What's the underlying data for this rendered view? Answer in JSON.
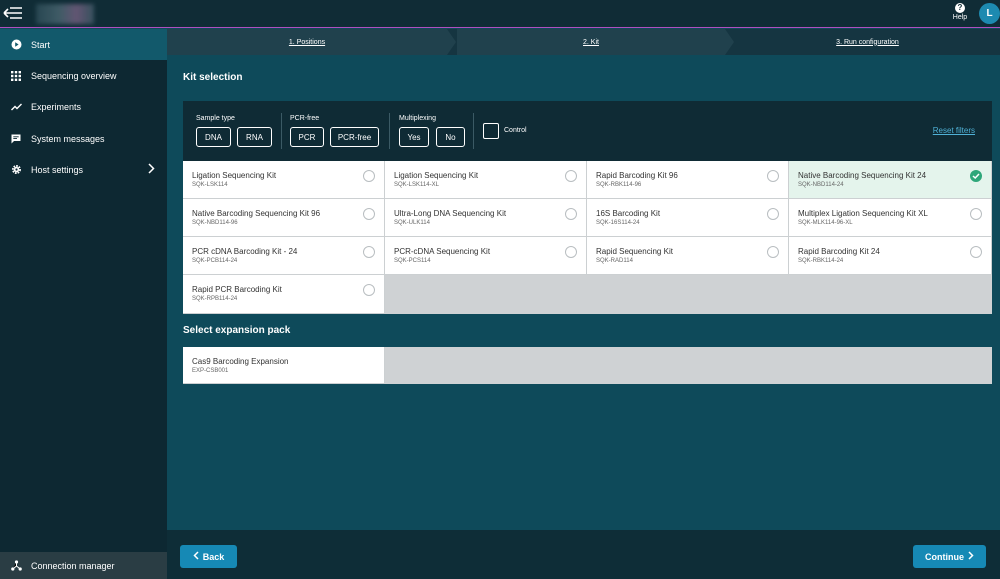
{
  "header": {
    "help_label": "Help",
    "avatar_initial": "L"
  },
  "sidebar": {
    "items": [
      {
        "label": "Start",
        "icon": "play-circle-icon"
      },
      {
        "label": "Sequencing overview",
        "icon": "grid-icon"
      },
      {
        "label": "Experiments",
        "icon": "trend-icon"
      },
      {
        "label": "System messages",
        "icon": "message-icon"
      },
      {
        "label": "Host settings",
        "icon": "gear-icon"
      }
    ],
    "connection_manager": "Connection manager"
  },
  "stepper": {
    "steps": [
      "1. Positions",
      "2. Kit",
      "3. Run configuration"
    ]
  },
  "kit_selection": {
    "title": "Kit selection",
    "filters": {
      "sample_type_label": "Sample type",
      "sample_type_options": [
        "DNA",
        "RNA"
      ],
      "pcr_free_label": "PCR-free",
      "pcr_free_options": [
        "PCR",
        "PCR-free"
      ],
      "multiplexing_label": "Multiplexing",
      "multiplexing_options": [
        "Yes",
        "No"
      ],
      "control_label": "Control",
      "reset_label": "Reset filters"
    },
    "kits": [
      {
        "name": "Ligation Sequencing Kit",
        "code": "SQK-LSK114"
      },
      {
        "name": "Ligation Sequencing Kit",
        "code": "SQK-LSK114-XL"
      },
      {
        "name": "Rapid Barcoding Kit 96",
        "code": "SQK-RBK114-96"
      },
      {
        "name": "Native Barcoding Sequencing Kit 24",
        "code": "SQK-NBD114-24"
      },
      {
        "name": "Native Barcoding Sequencing Kit 96",
        "code": "SQK-NBD114-96"
      },
      {
        "name": "Ultra-Long DNA Sequencing Kit",
        "code": "SQK-ULK114"
      },
      {
        "name": "16S Barcoding Kit",
        "code": "SQK-16S114-24"
      },
      {
        "name": "Multiplex Ligation Sequencing Kit XL",
        "code": "SQK-MLK114-96-XL"
      },
      {
        "name": "PCR cDNA Barcoding Kit - 24",
        "code": "SQK-PCB114-24"
      },
      {
        "name": "PCR-cDNA Sequencing Kit",
        "code": "SQK-PCS114"
      },
      {
        "name": "Rapid Sequencing Kit",
        "code": "SQK-RAD114"
      },
      {
        "name": "Rapid Barcoding Kit 24",
        "code": "SQK-RBK114-24"
      },
      {
        "name": "Rapid PCR Barcoding Kit",
        "code": "SQK-RPB114-24"
      }
    ],
    "selected_kit": "Native Barcoding Sequencing Kit 24"
  },
  "expansion": {
    "title": "Select expansion pack",
    "packs": [
      {
        "name": "Cas9 Barcoding Expansion",
        "code": "EXP-CSB001"
      }
    ]
  },
  "footer": {
    "back_label": "Back",
    "continue_label": "Continue"
  },
  "colors": {
    "accent": "#1689b5",
    "selected_check": "#2fa77a",
    "background": "#0e4a5a"
  }
}
